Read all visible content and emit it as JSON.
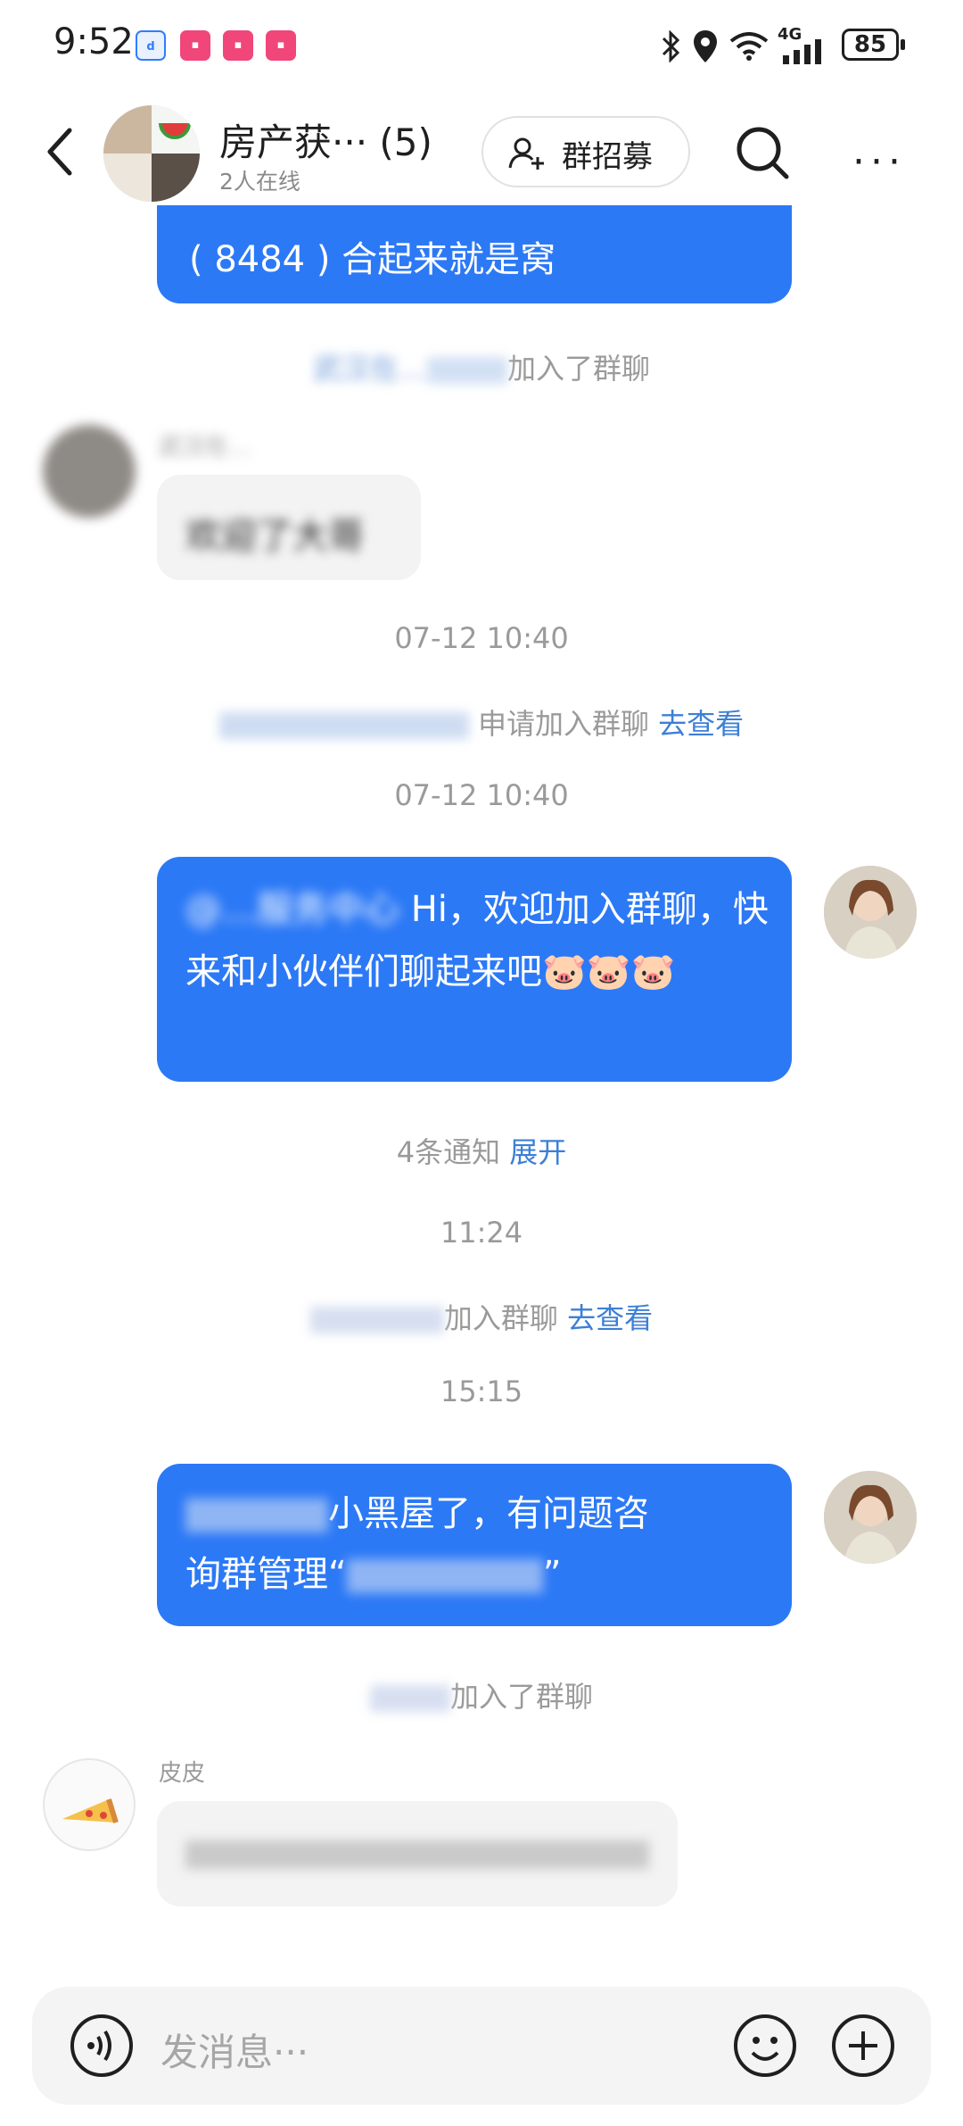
{
  "status_bar": {
    "time": "9:52",
    "network": "4G",
    "battery": "85",
    "app_icons": [
      "app-blue-icon",
      "app-pink-icon",
      "app-pink-icon",
      "app-pink-icon"
    ]
  },
  "header": {
    "group_name": "房产获··· (5)",
    "online": "2人在线",
    "recruit_label": "群招募"
  },
  "messages": {
    "m1_text": "( 8484 ) 合起来就是窝",
    "sys1_tail": "加入了群聊",
    "sys1_name_blurred": "武汉在…",
    "m2_sender_blurred": "武汉在…",
    "m2_text_blurred": "欢迎了大哥",
    "time1": "07-12 10:40",
    "sys2_tail": "申请加入群聊",
    "sys2_link": "去查看",
    "time2": "07-12 10:40",
    "m3_prefix_blurred": "@…服务中心",
    "m3_text": " Hi，欢迎加入群聊，快来和小伙伴们聊起来吧",
    "m3_emoji": [
      "🐷",
      "🐷",
      "🐷"
    ],
    "notice_count": "4条通知",
    "notice_link": "展开",
    "time3": "11:24",
    "sys3_tail": "加入群聊",
    "sys3_link": "去查看",
    "time4": "15:15",
    "m4_line1_visible": "小黑屋了，有问题咨",
    "m4_line2_visible": "询群管理“",
    "m4_line2_end": "”",
    "sys4_tail": "加入了群聊",
    "m5_sender": "皮皮",
    "m5_text_blurred": "…"
  },
  "input": {
    "placeholder": "发消息···"
  },
  "colors": {
    "accent_blue": "#2c79f6",
    "link_blue": "#3d7fd6",
    "system_text": "#9a9a9a"
  }
}
